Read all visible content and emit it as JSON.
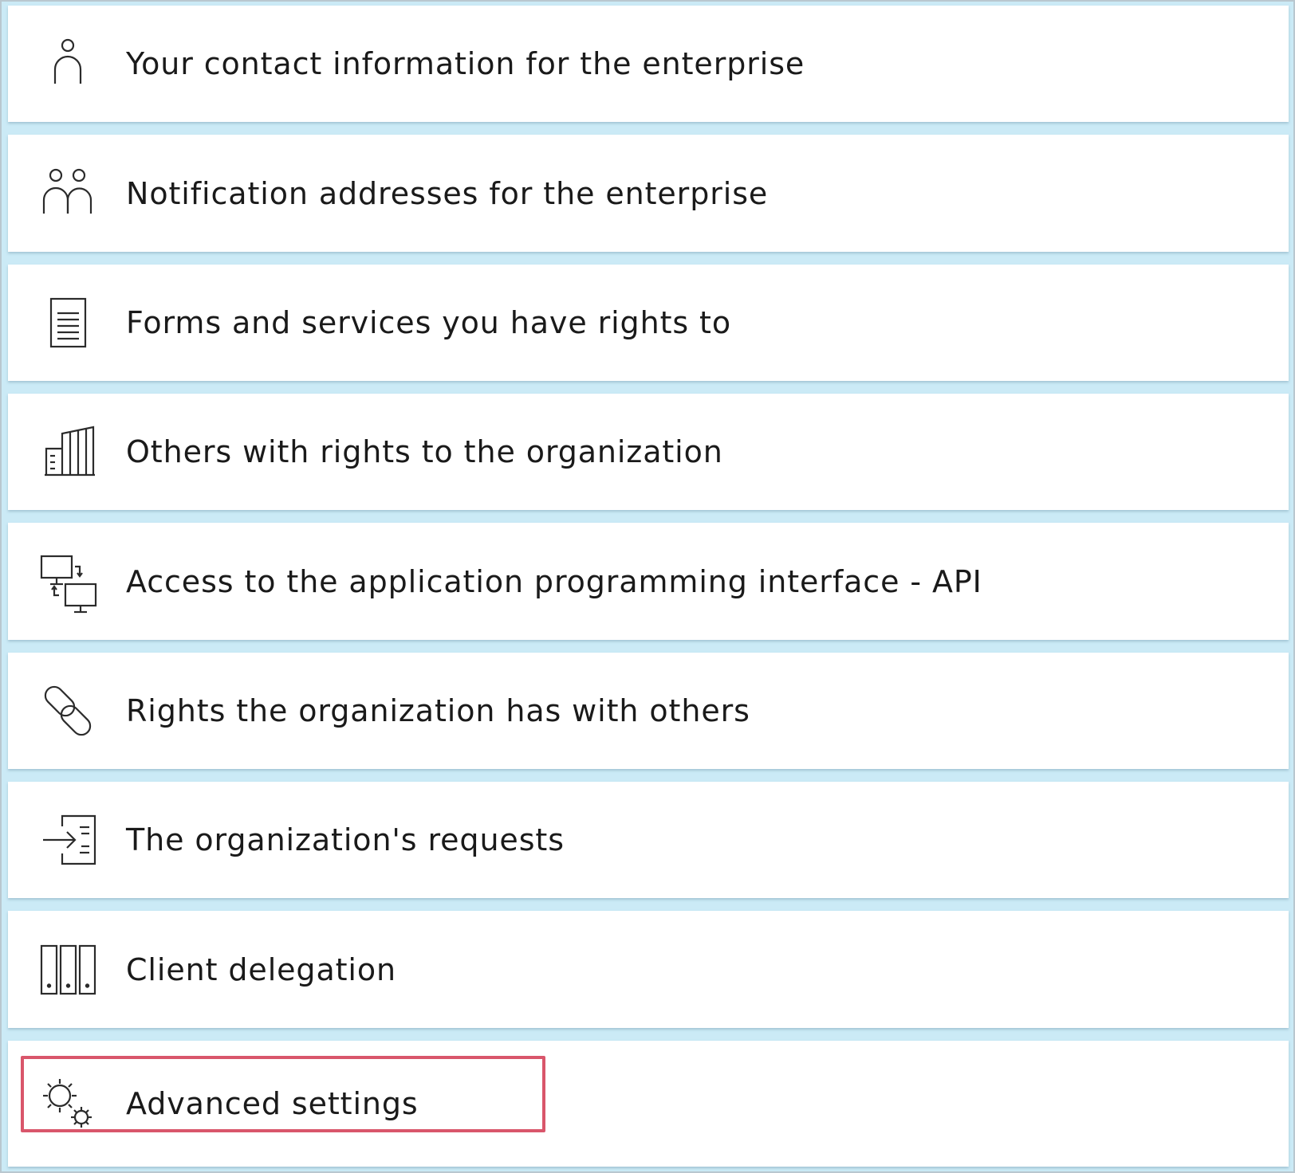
{
  "menu": {
    "items": [
      {
        "label": "Your contact information for the enterprise",
        "icon": "person-icon"
      },
      {
        "label": "Notification addresses for the enterprise",
        "icon": "two-people-icon"
      },
      {
        "label": "Forms and services you have rights to",
        "icon": "document-icon"
      },
      {
        "label": "Others with rights to the organization",
        "icon": "building-icon"
      },
      {
        "label": "Access to the application programming interface - API",
        "icon": "connected-computers-icon"
      },
      {
        "label": "Rights the organization has with others",
        "icon": "link-icon"
      },
      {
        "label": "The organization's requests",
        "icon": "inbox-arrow-document-icon"
      },
      {
        "label": "Client delegation",
        "icon": "binders-icon"
      },
      {
        "label": "Advanced settings",
        "icon": "gears-icon",
        "highlighted": true
      }
    ]
  },
  "colors": {
    "background": "#cbeaf6",
    "card": "#ffffff",
    "highlight_border": "#d9566b",
    "text": "#1a1a1a",
    "icon_stroke": "#2b2b2b"
  }
}
